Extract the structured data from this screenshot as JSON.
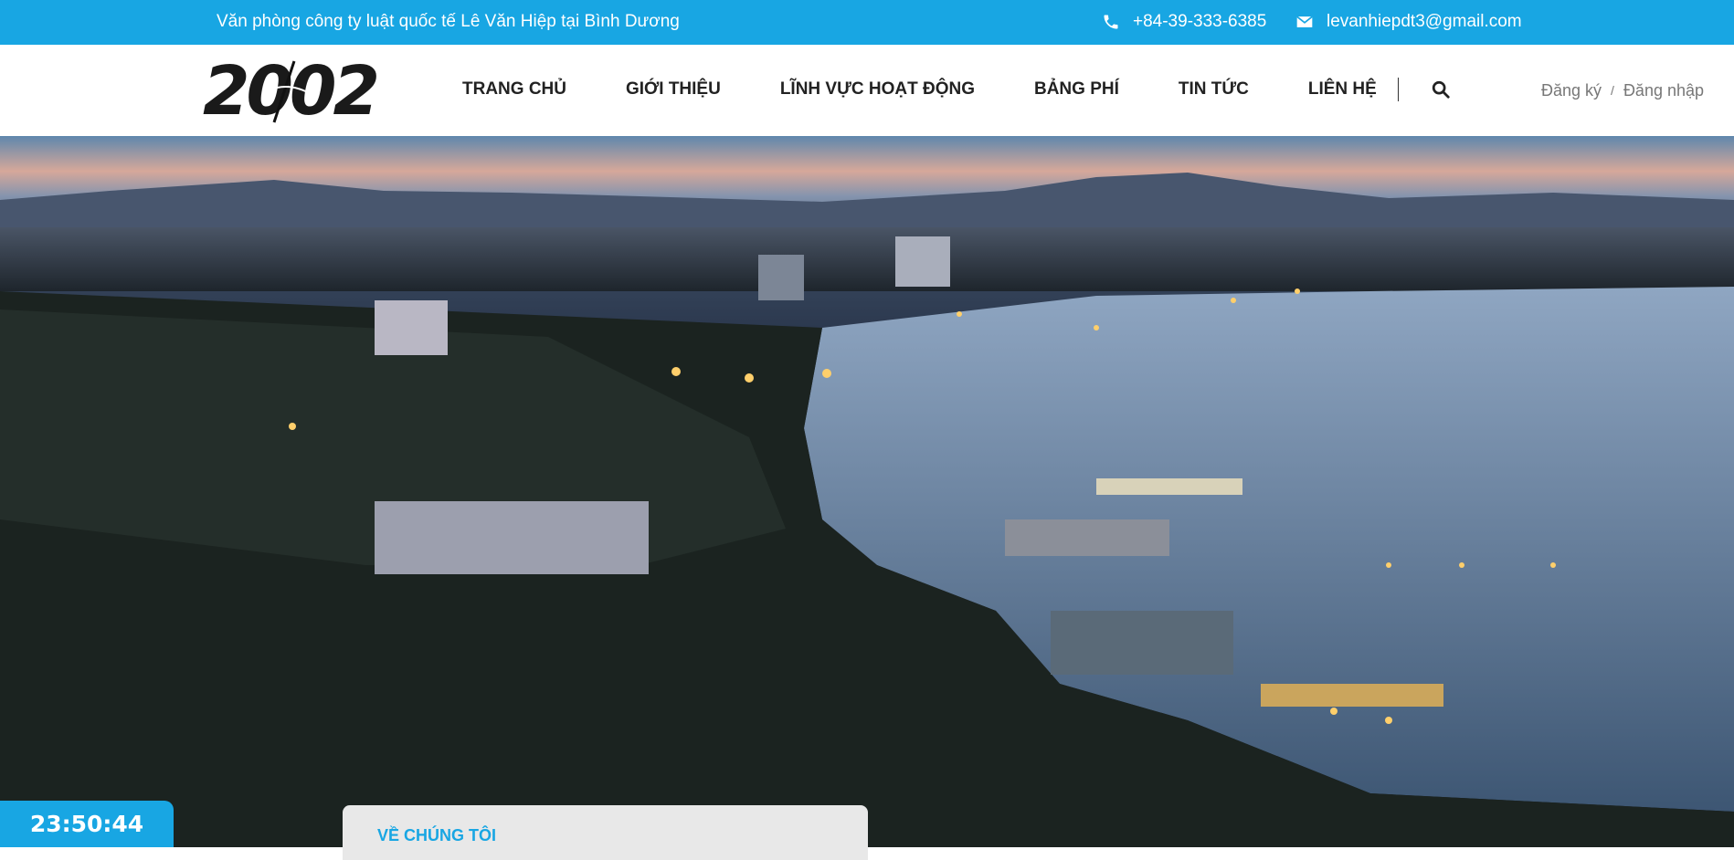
{
  "topbar": {
    "office_text": "Văn phòng công ty luật quốc tế Lê Văn Hiệp tại Bình Dương",
    "phone": "+84-39-333-6385",
    "email": "levanhiepdt3@gmail.com",
    "phone_icon": "phone-icon",
    "email_icon": "envelope-icon"
  },
  "header": {
    "logo_text": "2002",
    "nav": [
      {
        "label": "TRANG CHỦ"
      },
      {
        "label": "GIỚI THIỆU"
      },
      {
        "label": "LĨNH VỰC HOẠT ĐỘNG"
      },
      {
        "label": "BẢNG PHÍ"
      },
      {
        "label": "TIN TỨC"
      },
      {
        "label": "LIÊN HỆ"
      }
    ],
    "search_icon": "search-icon",
    "auth": {
      "register": "Đăng ký",
      "separator": "/",
      "login": "Đăng nhập"
    }
  },
  "clock": {
    "time": "23:50:44"
  },
  "about": {
    "title": "VỀ CHÚNG TÔI"
  },
  "colors": {
    "accent": "#18a6e3",
    "nav_text": "#222222",
    "auth_text": "#777777"
  }
}
